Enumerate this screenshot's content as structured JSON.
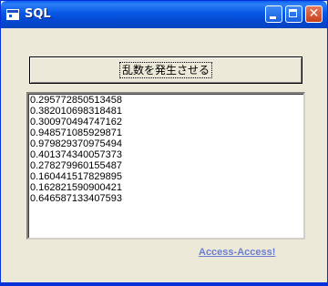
{
  "window": {
    "title": "SQL"
  },
  "main": {
    "button_label": "乱数を発生させる",
    "list_items": [
      "0.295772850513458",
      "0.382010698318481",
      "0.300970494747162",
      "0.948571085929871",
      "0.979829370975494",
      "0.401374340057373",
      "0.278279960155487",
      "0.160441517829895",
      "0.162821590900421",
      "0.646587133407593"
    ],
    "link_text": "Access-Access!"
  }
}
